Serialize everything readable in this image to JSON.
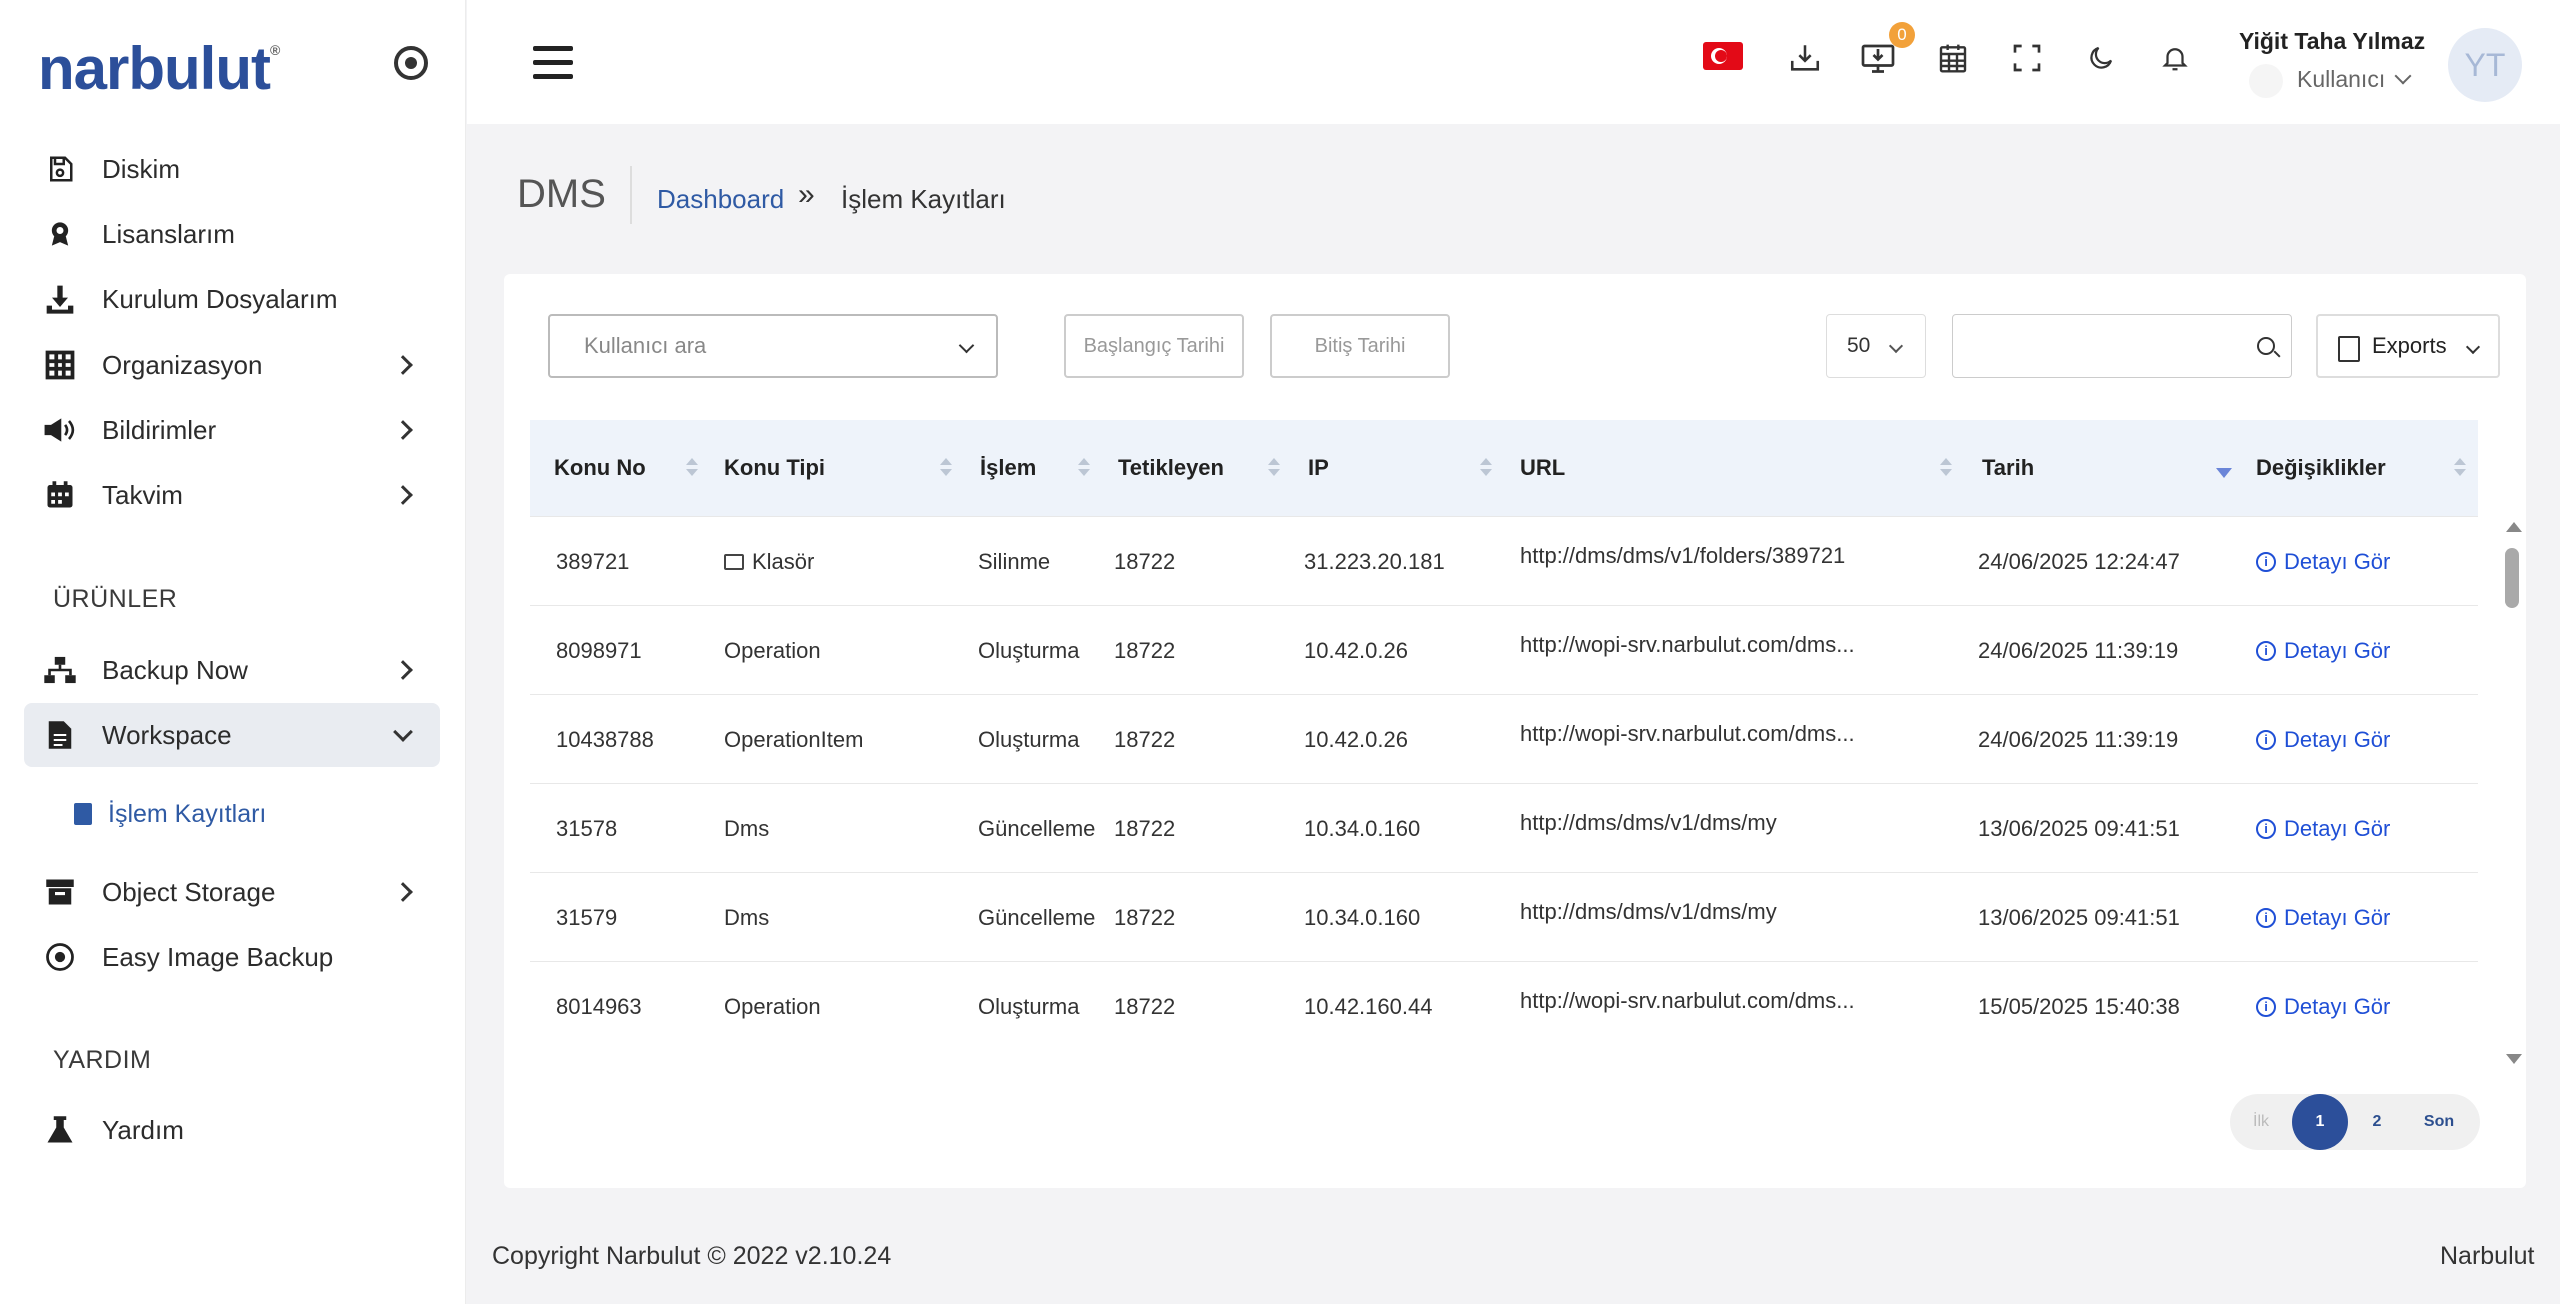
{
  "brand": {
    "name": "narbulut",
    "reg": "®"
  },
  "sidebar": {
    "items": [
      {
        "label": "Diskim",
        "icon": "save-icon"
      },
      {
        "label": "Lisanslarım",
        "icon": "award-icon"
      },
      {
        "label": "Kurulum Dosyalarım",
        "icon": "download-icon"
      },
      {
        "label": "Organizasyon",
        "icon": "grid-icon"
      },
      {
        "label": "Bildirimler",
        "icon": "megaphone-icon"
      },
      {
        "label": "Takvim",
        "icon": "calendar-icon"
      }
    ],
    "products_label": "ÜRÜNLER",
    "products": [
      {
        "label": "Backup Now",
        "icon": "sitemap-icon"
      },
      {
        "label": "Workspace",
        "icon": "file-icon"
      },
      {
        "label": "Object Storage",
        "icon": "archive-icon"
      },
      {
        "label": "Easy Image Backup",
        "icon": "disc-icon"
      }
    ],
    "sub_item": "İşlem Kayıtları",
    "help_label": "YARDIM",
    "help": [
      {
        "label": "Yardım",
        "icon": "flask-icon"
      }
    ]
  },
  "header": {
    "badge_count": "0",
    "user_name": "Yiğit Taha Yılmaz",
    "user_role": "Kullanıcı",
    "avatar_initials": "YT"
  },
  "breadcrumb": {
    "title": "DMS",
    "home": "Dashboard",
    "separator": "»",
    "current": "İşlem Kayıtları"
  },
  "filters": {
    "user_placeholder": "Kullanıcı ara",
    "start_date_placeholder": "Başlangıç Tarihi",
    "end_date_placeholder": "Bitiş Tarihi",
    "per_page": "50",
    "exports_label": "Exports"
  },
  "table": {
    "columns": [
      "Konu No",
      "Konu Tipi",
      "İşlem",
      "Tetikleyen",
      "IP",
      "URL",
      "Tarih",
      "Değişiklikler"
    ],
    "detail_label": "Detayı Gör",
    "rows": [
      {
        "no": "389721",
        "type": "Klasör",
        "action": "Silinme",
        "trigger": "18722",
        "ip": "31.223.20.181",
        "url": "http://dms/dms/v1/folders/389721",
        "date": "24/06/2025 12:24:47"
      },
      {
        "no": "8098971",
        "type": "Operation",
        "action": "Oluşturma",
        "trigger": "18722",
        "ip": "10.42.0.26",
        "url": "http://wopi-srv.narbulut.com/dms...",
        "date": "24/06/2025 11:39:19"
      },
      {
        "no": "10438788",
        "type": "OperationItem",
        "action": "Oluşturma",
        "trigger": "18722",
        "ip": "10.42.0.26",
        "url": "http://wopi-srv.narbulut.com/dms...",
        "date": "24/06/2025 11:39:19"
      },
      {
        "no": "31578",
        "type": "Dms",
        "action": "Güncelleme",
        "trigger": "18722",
        "ip": "10.34.0.160",
        "url": "http://dms/dms/v1/dms/my",
        "date": "13/06/2025 09:41:51"
      },
      {
        "no": "31579",
        "type": "Dms",
        "action": "Güncelleme",
        "trigger": "18722",
        "ip": "10.34.0.160",
        "url": "http://dms/dms/v1/dms/my",
        "date": "13/06/2025 09:41:51"
      },
      {
        "no": "8014963",
        "type": "Operation",
        "action": "Oluşturma",
        "trigger": "18722",
        "ip": "10.42.160.44",
        "url": "http://wopi-srv.narbulut.com/dms...",
        "date": "15/05/2025 15:40:38"
      }
    ]
  },
  "pagination": {
    "first": "İlk",
    "pages": [
      "1",
      "2"
    ],
    "current": "1",
    "last": "Son"
  },
  "footer": {
    "copyright": "Copyright Narbulut © 2022  v2.10.24",
    "brand": "Narbulut"
  }
}
